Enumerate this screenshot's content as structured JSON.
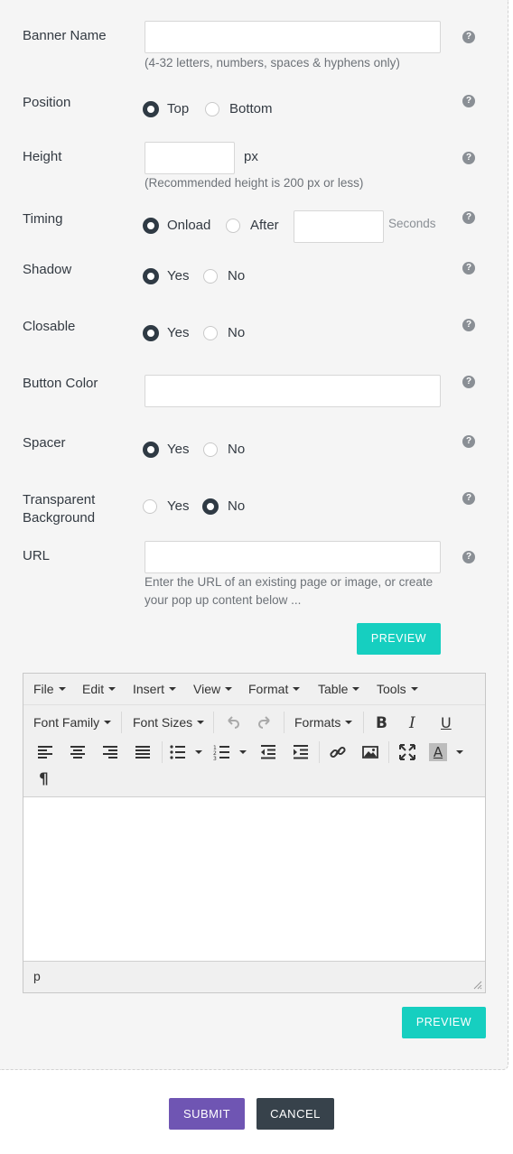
{
  "form": {
    "banner_name": {
      "label": "Banner Name",
      "value": "",
      "help": "(4-32 letters, numbers, spaces & hyphens only)"
    },
    "position": {
      "label": "Position",
      "options": [
        "Top",
        "Bottom"
      ],
      "selected": "Top"
    },
    "height": {
      "label": "Height",
      "value": "",
      "unit": "px",
      "help": "(Recommended height is 200 px or less)"
    },
    "timing": {
      "label": "Timing",
      "options": [
        "Onload",
        "After"
      ],
      "selected": "Onload",
      "seconds_value": "",
      "seconds_label": "Seconds"
    },
    "shadow": {
      "label": "Shadow",
      "options": [
        "Yes",
        "No"
      ],
      "selected": "Yes"
    },
    "closable": {
      "label": "Closable",
      "options": [
        "Yes",
        "No"
      ],
      "selected": "Yes"
    },
    "button_color": {
      "label": "Button Color",
      "value": ""
    },
    "spacer": {
      "label": "Spacer",
      "options": [
        "Yes",
        "No"
      ],
      "selected": "Yes"
    },
    "transparent_bg": {
      "label_line1": "Transparent",
      "label_line2": "Background",
      "options": [
        "Yes",
        "No"
      ],
      "selected": "No"
    },
    "url": {
      "label": "URL",
      "value": "",
      "help_line1": "Enter the URL of an existing page or image, or create",
      "help_line2": "your pop up content below ..."
    },
    "help_glyph": "?",
    "preview_label": "PREVIEW"
  },
  "editor": {
    "menus": [
      "File",
      "Edit",
      "Insert",
      "View",
      "Format",
      "Table",
      "Tools"
    ],
    "font_family_label": "Font Family",
    "font_sizes_label": "Font Sizes",
    "formats_label": "Formats",
    "status_path": "p",
    "icons": [
      "undo-icon",
      "redo-icon",
      "bold-icon",
      "italic-icon",
      "underline-icon",
      "align-left-icon",
      "align-center-icon",
      "align-right-icon",
      "align-justify-icon",
      "bullet-list-icon",
      "numbered-list-icon",
      "outdent-icon",
      "indent-icon",
      "link-icon",
      "image-icon",
      "fullscreen-icon",
      "text-color-icon",
      "paragraph-icon"
    ]
  },
  "actions": {
    "preview_label": "PREVIEW",
    "submit_label": "SUBMIT",
    "cancel_label": "CANCEL"
  },
  "colors": {
    "teal": "#16cfc0",
    "submit": "#6f55b3",
    "cancel": "#37424b",
    "radio_on": "#2f3a44"
  }
}
